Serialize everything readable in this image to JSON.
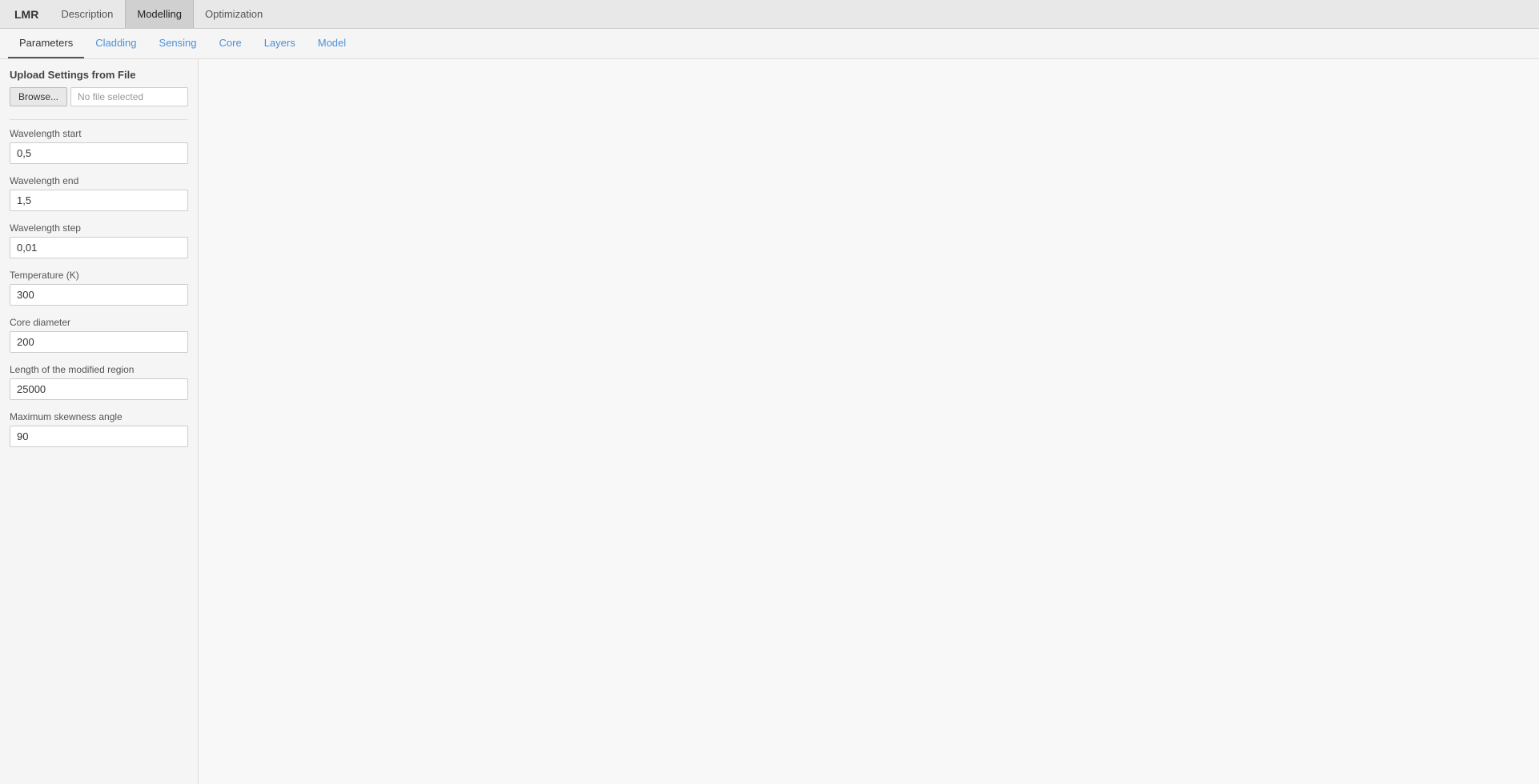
{
  "top_nav": {
    "brand": "LMR",
    "items": [
      {
        "id": "description",
        "label": "Description",
        "active": false
      },
      {
        "id": "modelling",
        "label": "Modelling",
        "active": true
      },
      {
        "id": "optimization",
        "label": "Optimization",
        "active": false
      }
    ]
  },
  "sub_tabs": {
    "items": [
      {
        "id": "parameters",
        "label": "Parameters",
        "active": true
      },
      {
        "id": "cladding",
        "label": "Cladding",
        "active": false
      },
      {
        "id": "sensing",
        "label": "Sensing",
        "active": false
      },
      {
        "id": "core",
        "label": "Core",
        "active": false
      },
      {
        "id": "layers",
        "label": "Layers",
        "active": false
      },
      {
        "id": "model",
        "label": "Model",
        "active": false
      }
    ]
  },
  "left_panel": {
    "upload_section": {
      "title": "Upload Settings from File",
      "browse_label": "Browse...",
      "file_placeholder": "No file selected"
    },
    "fields": [
      {
        "id": "wavelength_start",
        "label": "Wavelength start",
        "value": "0,5"
      },
      {
        "id": "wavelength_end",
        "label": "Wavelength end",
        "value": "1,5"
      },
      {
        "id": "wavelength_step",
        "label": "Wavelength step",
        "value": "0,01"
      },
      {
        "id": "temperature",
        "label": "Temperature (K)",
        "value": "300"
      },
      {
        "id": "core_diameter",
        "label": "Core diameter",
        "value": "200"
      },
      {
        "id": "length_modified",
        "label": "Length of the modified region",
        "value": "25000"
      },
      {
        "id": "max_skewness",
        "label": "Maximum skewness angle",
        "value": "90"
      }
    ]
  }
}
